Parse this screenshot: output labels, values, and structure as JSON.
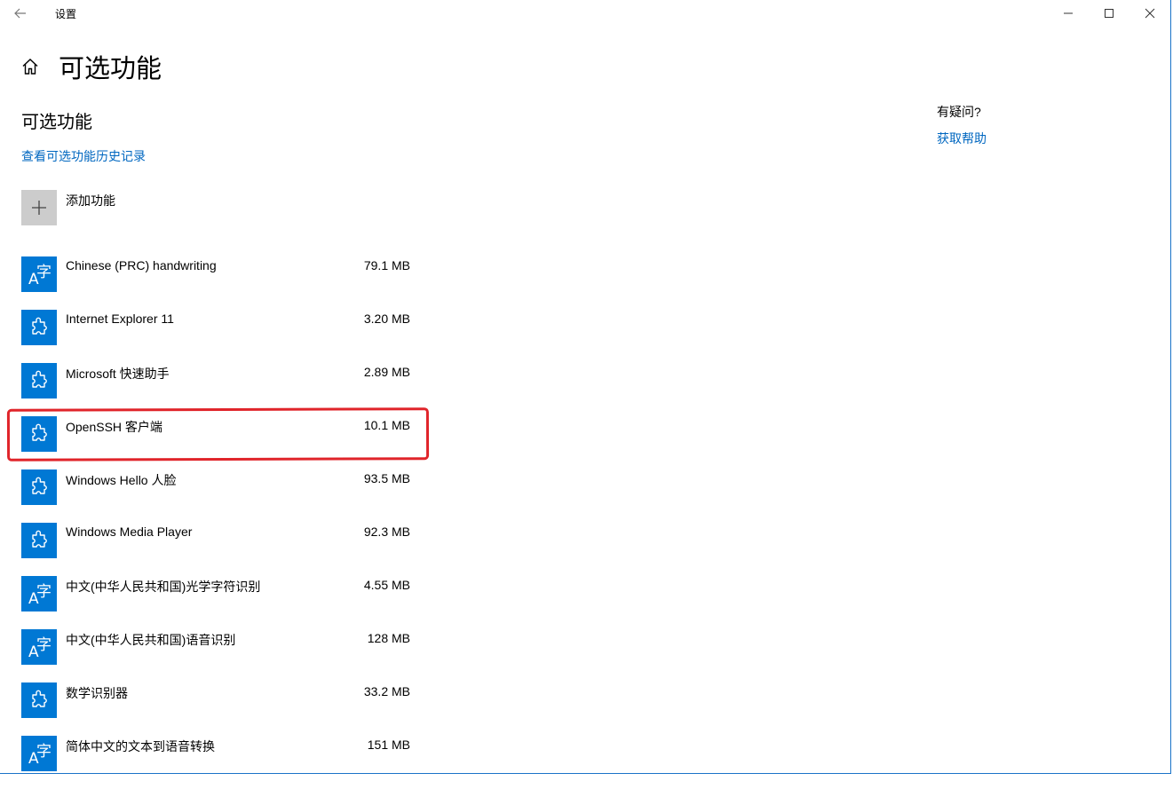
{
  "window": {
    "title": "设置",
    "back_icon": "back-arrow-icon",
    "controls": [
      "minimize-icon",
      "maximize-icon",
      "close-icon"
    ]
  },
  "page": {
    "title": "可选功能",
    "section_title": "可选功能",
    "history_link": "查看可选功能历史记录",
    "add_feature_label": "添加功能"
  },
  "help": {
    "question": "有疑问?",
    "link": "获取帮助"
  },
  "features": [
    {
      "name": "Chinese (PRC) handwriting",
      "size": "79.1 MB",
      "icon": "language-icon"
    },
    {
      "name": "Internet Explorer 11",
      "size": "3.20 MB",
      "icon": "puzzle-icon"
    },
    {
      "name": "Microsoft 快速助手",
      "size": "2.89 MB",
      "icon": "puzzle-icon"
    },
    {
      "name": "OpenSSH 客户端",
      "size": "10.1 MB",
      "icon": "puzzle-icon"
    },
    {
      "name": "Windows Hello 人脸",
      "size": "93.5 MB",
      "icon": "puzzle-icon"
    },
    {
      "name": "Windows Media Player",
      "size": "92.3 MB",
      "icon": "puzzle-icon"
    },
    {
      "name": "中文(中华人民共和国)光学字符识别",
      "size": "4.55 MB",
      "icon": "language-icon"
    },
    {
      "name": "中文(中华人民共和国)语音识别",
      "size": "128 MB",
      "icon": "language-icon"
    },
    {
      "name": "数学识别器",
      "size": "33.2 MB",
      "icon": "puzzle-icon"
    },
    {
      "name": "简体中文的文本到语音转换",
      "size": "151 MB",
      "icon": "language-icon"
    }
  ],
  "annotation_color": "#e0242a",
  "accent_color": "#0078d4"
}
